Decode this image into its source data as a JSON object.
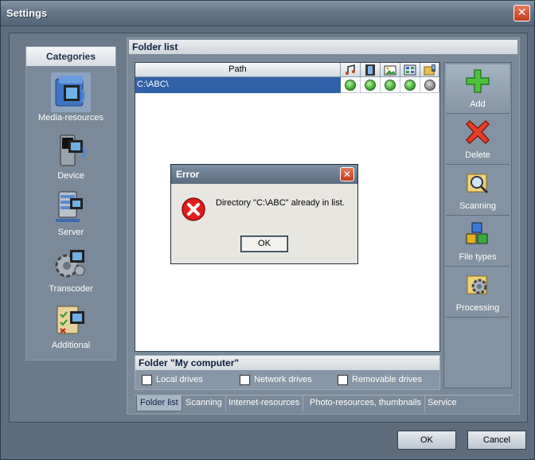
{
  "window": {
    "title": "Settings",
    "close_glyph": "✕"
  },
  "categories": {
    "header": "Categories",
    "items": [
      {
        "label": "Media-resources",
        "icon": "media-resources-icon",
        "selected": true
      },
      {
        "label": "Device",
        "icon": "device-icon",
        "selected": false
      },
      {
        "label": "Server",
        "icon": "server-icon",
        "selected": false
      },
      {
        "label": "Transcoder",
        "icon": "transcoder-icon",
        "selected": false
      },
      {
        "label": "Additional",
        "icon": "additional-icon",
        "selected": false
      }
    ]
  },
  "folder_list": {
    "header": "Folder list",
    "columns": {
      "path": "Path",
      "icons": [
        "music-icon",
        "video-icon",
        "photo-icon",
        "playlist-icon",
        "folder-icon"
      ]
    },
    "rows": [
      {
        "path": "C:\\ABC\\",
        "flags": [
          "green",
          "green",
          "green",
          "green",
          "gray"
        ]
      }
    ]
  },
  "side_buttons": [
    {
      "label": "Add",
      "icon": "add-icon"
    },
    {
      "label": "Delete",
      "icon": "delete-icon"
    },
    {
      "label": "Scanning",
      "icon": "scanning-icon"
    },
    {
      "label": "File types",
      "icon": "file-types-icon"
    },
    {
      "label": "Processing",
      "icon": "processing-icon"
    }
  ],
  "my_computer": {
    "title": "Folder \"My computer\"",
    "options": [
      {
        "label": "Local drives",
        "checked": false
      },
      {
        "label": "Network drives",
        "checked": false
      },
      {
        "label": "Removable drives",
        "checked": false
      }
    ]
  },
  "tabs": [
    {
      "label": "Folder list",
      "active": true
    },
    {
      "label": "Scanning",
      "active": false
    },
    {
      "label": "Internet-resources",
      "active": false
    },
    {
      "label": "Photo-resources, thumbnails",
      "active": false
    },
    {
      "label": "Service",
      "active": false
    }
  ],
  "footer": {
    "ok": "OK",
    "cancel": "Cancel"
  },
  "error_dialog": {
    "title": "Error",
    "message": "Directory \"C:\\ABC\" already in list.",
    "ok": "OK",
    "close_glyph": "✕"
  },
  "colors": {
    "accent": "#3061a8",
    "panel": "#7a8a9a",
    "titlebar": "#647588"
  }
}
